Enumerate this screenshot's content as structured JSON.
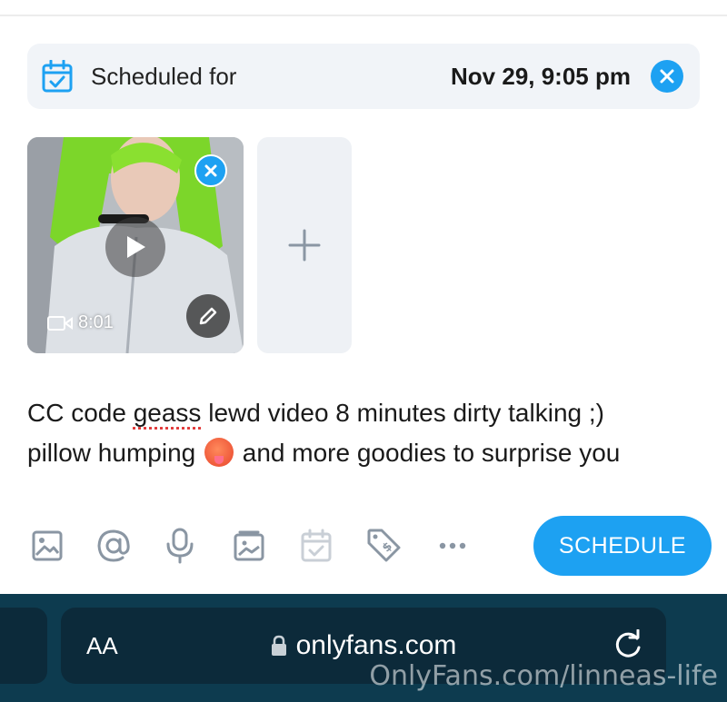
{
  "schedule": {
    "label": "Scheduled for",
    "date": "Nov 29, 9:05 pm",
    "calendar_icon": "calendar-check-icon",
    "clear_icon": "close-icon"
  },
  "media": {
    "duration": "8:01",
    "play_icon": "play-icon",
    "edit_icon": "pencil-icon",
    "remove_icon": "close-icon",
    "add_icon": "plus-icon"
  },
  "post": {
    "line1_before": "CC code ",
    "line1_misspelled": "geass",
    "line1_after": " lewd video 8 minutes dirty talking ;)",
    "line2_before": "pillow humping ",
    "line2_emoji": "hot-face-emoji",
    "line2_after": " and more goodies to surprise you"
  },
  "toolbar": {
    "icons": [
      "image-icon",
      "mention-icon",
      "microphone-icon",
      "vault-icon",
      "calendar-icon",
      "price-tag-icon",
      "more-icon"
    ],
    "schedule_label": "SCHEDULE"
  },
  "browser": {
    "text_size_label": "AA",
    "url": "onlyfans.com",
    "lock_icon": "lock-icon",
    "reload_icon": "reload-icon",
    "watermark": "OnlyFans.com/linneas-life"
  },
  "colors": {
    "accent": "#1da1f2",
    "browser_bar": "#0d3b4f",
    "url_box": "#0c2a3a"
  }
}
